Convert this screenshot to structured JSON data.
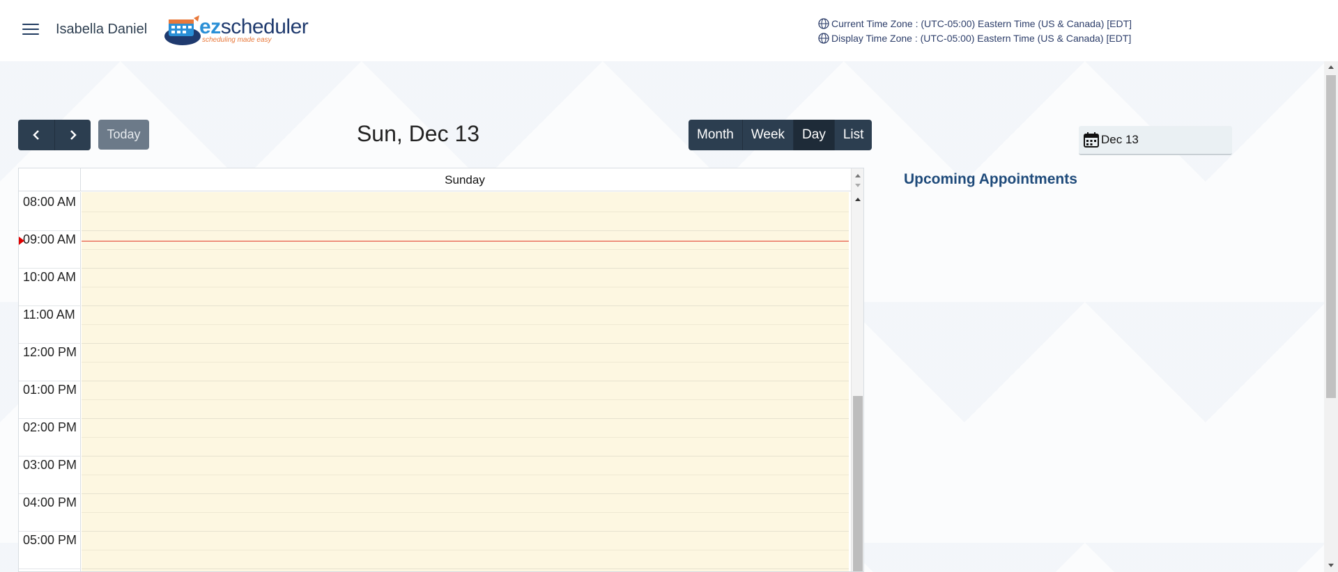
{
  "header": {
    "user_name": "Isabella Daniel",
    "logo": {
      "brand_ez": "ez",
      "brand_rest": "scheduler",
      "tagline": "scheduling made easy"
    },
    "timezones": [
      "Current Time Zone : (UTC-05:00) Eastern Time (US & Canada) [EDT]",
      "Display Time Zone : (UTC-05:00) Eastern Time (US & Canada) [EDT]"
    ]
  },
  "toolbar": {
    "prev_icon": "chevron-left-icon",
    "next_icon": "chevron-right-icon",
    "today_label": "Today",
    "title": "Sun, Dec 13",
    "views": [
      "Month",
      "Week",
      "Day",
      "List"
    ],
    "active_view": "Day"
  },
  "calendar": {
    "day_header": "Sunday",
    "time_slots": [
      "08:00 AM",
      "09:00 AM",
      "10:00 AM",
      "11:00 AM",
      "12:00 PM",
      "01:00 PM",
      "02:00 PM",
      "03:00 PM",
      "04:00 PM",
      "05:00 PM"
    ],
    "current_time_indicator": "09:00 AM",
    "colors": {
      "day_bg": "#fdf7e1",
      "now_line": "#e23b2a",
      "toolbar": "#2c3e50"
    }
  },
  "sidebar": {
    "date_picker_label": "Dec 13",
    "upcoming_title": "Upcoming Appointments"
  }
}
